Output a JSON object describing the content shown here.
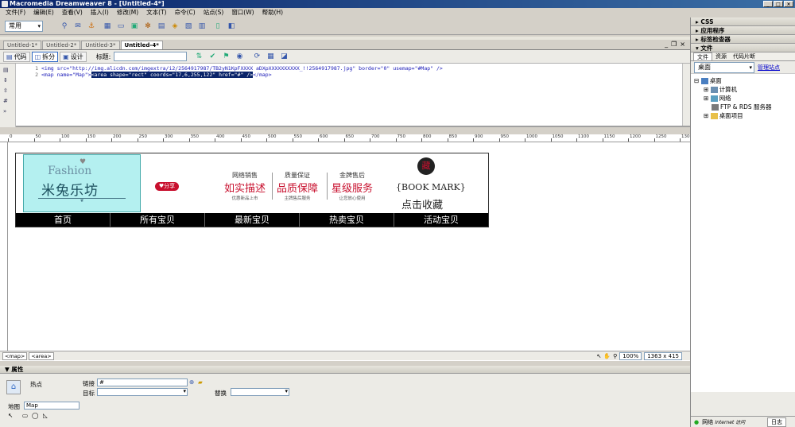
{
  "window": {
    "title": "Macromedia Dreamweaver 8 - [Untitled-4*]"
  },
  "menu": [
    "文件(F)",
    "编辑(E)",
    "查看(V)",
    "插入(I)",
    "修改(M)",
    "文本(T)",
    "命令(C)",
    "站点(S)",
    "窗口(W)",
    "帮助(H)"
  ],
  "insert_toolbar": {
    "category": "常用"
  },
  "doc_tabs": [
    "Untitled-1*",
    "Untitled-2*",
    "Untitled-3*",
    "Untitled-4*"
  ],
  "doc_toolbar": {
    "code": "代码",
    "split": "拆分",
    "design": "设计",
    "title_label": "标题:"
  },
  "code": {
    "line_numbers": [
      "1",
      "2"
    ],
    "line1": "<img src=\"http://img.alicdn.com/imgextra/i2/2564917987/TB2yN1KpFXXXX aDXpXXXXXXXXXX_!!2564917987.jpg\" border=\"0\" usemap=\"#Map\" />",
    "line2_pre": "<map name=\"Map\">",
    "line2_sel": "<area shape=\"rect\" coords=\"17,6,255,122\" href=\"#\" />",
    "line2_post": "</map>"
  },
  "ruler_labels": [
    "0",
    "50",
    "100",
    "150",
    "200",
    "250",
    "300",
    "350",
    "400",
    "450",
    "500",
    "550",
    "600",
    "650",
    "700",
    "750",
    "800",
    "850",
    "900",
    "950",
    "1000",
    "1050",
    "1100",
    "1150",
    "1200",
    "1250",
    "1300"
  ],
  "banner": {
    "logo_en": "Fashion",
    "logo_cn": "米兔乐坊",
    "share": "♥分享",
    "services": [
      {
        "top": "网络销售",
        "main": "如实描述",
        "sub": "优惠新品上市"
      },
      {
        "top": "质量保证",
        "main": "品质保障",
        "sub": "主牌售后服务"
      },
      {
        "top": "金牌售后",
        "main": "星级服务",
        "sub": "让您放心使用"
      }
    ],
    "seal": "藏",
    "bookmark": "{BOOK MARK}",
    "click_fav": "点击收藏",
    "nav": [
      "首页",
      "所有宝贝",
      "最新宝贝",
      "热卖宝贝",
      "活动宝贝"
    ]
  },
  "status": {
    "tags": [
      "<map>",
      "<area>"
    ],
    "zoom": "100%",
    "size": "1363 x 415"
  },
  "properties": {
    "header": "属性",
    "hotspot": "热点",
    "link_label": "链接",
    "link_value": "#",
    "target_label": "目标",
    "alt_label": "替换",
    "map_label": "地图",
    "map_value": "Map"
  },
  "right_panel": {
    "sections": [
      "CSS",
      "应用程序",
      "标签检查器",
      "文件"
    ],
    "tabs": [
      "文件",
      "资源",
      "代码片断"
    ],
    "site_select": "桌面",
    "manage_link": "管理站点",
    "tree": [
      "桌面",
      "计算机",
      "网络",
      "FTP & RDS 服务器",
      "桌面项目"
    ],
    "footer_label": "网络",
    "footer_sub": "Internet 访问",
    "log_button": "日志"
  },
  "colors": {
    "accent_red": "#c8102e",
    "logo_bg": "#b4f0f0",
    "title_blue": "#0a246a"
  }
}
